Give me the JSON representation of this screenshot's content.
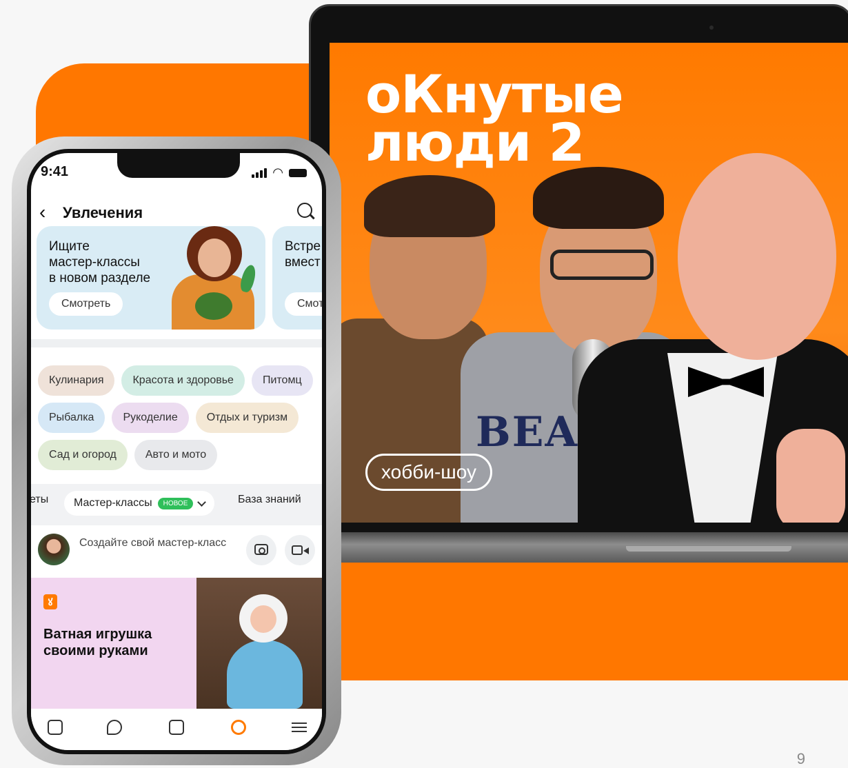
{
  "page_number": "9",
  "laptop": {
    "show_title": "оКнутые\nлюди 2",
    "show_badge": "хобби-шоу",
    "shirt_text": "BEAR"
  },
  "phone": {
    "status_time": "9:41",
    "header": {
      "title": "Увлечения"
    },
    "promos": [
      {
        "text": "Ищите\nмастер-классы\nв новом разделе",
        "button": "Смотреть"
      },
      {
        "text": "Встре\nвмест",
        "button": "Смот"
      }
    ],
    "chips": {
      "row1": [
        {
          "label": "Кулинария",
          "color": "#efe2d9"
        },
        {
          "label": "Красота и здоровье",
          "color": "#d3ede5"
        },
        {
          "label": "Питомц",
          "color": "#e7e5f4"
        }
      ],
      "row2": [
        {
          "label": "Рыбалка",
          "color": "#d6e8f6"
        },
        {
          "label": "Рукоделие",
          "color": "#ecdcf0"
        },
        {
          "label": "Отдых и туризм",
          "color": "#f4e8d5"
        }
      ],
      "row3": [
        {
          "label": "Сад и огород",
          "color": "#e1ecd6"
        },
        {
          "label": "Авто и мото",
          "color": "#e8e9ec"
        }
      ]
    },
    "tabs": {
      "left_partial": "еты",
      "active": "Мастер-классы",
      "new_badge": "НОВОЕ",
      "right": "База знаний"
    },
    "create_post": {
      "text": "Создайте свой мастер-класс"
    },
    "feed_card": {
      "logo": "ok",
      "title": "Ватная игрушка\nсвоими руками"
    }
  },
  "colors": {
    "brand_orange": "#ff7700",
    "accent_green": "#2fbf5a"
  }
}
